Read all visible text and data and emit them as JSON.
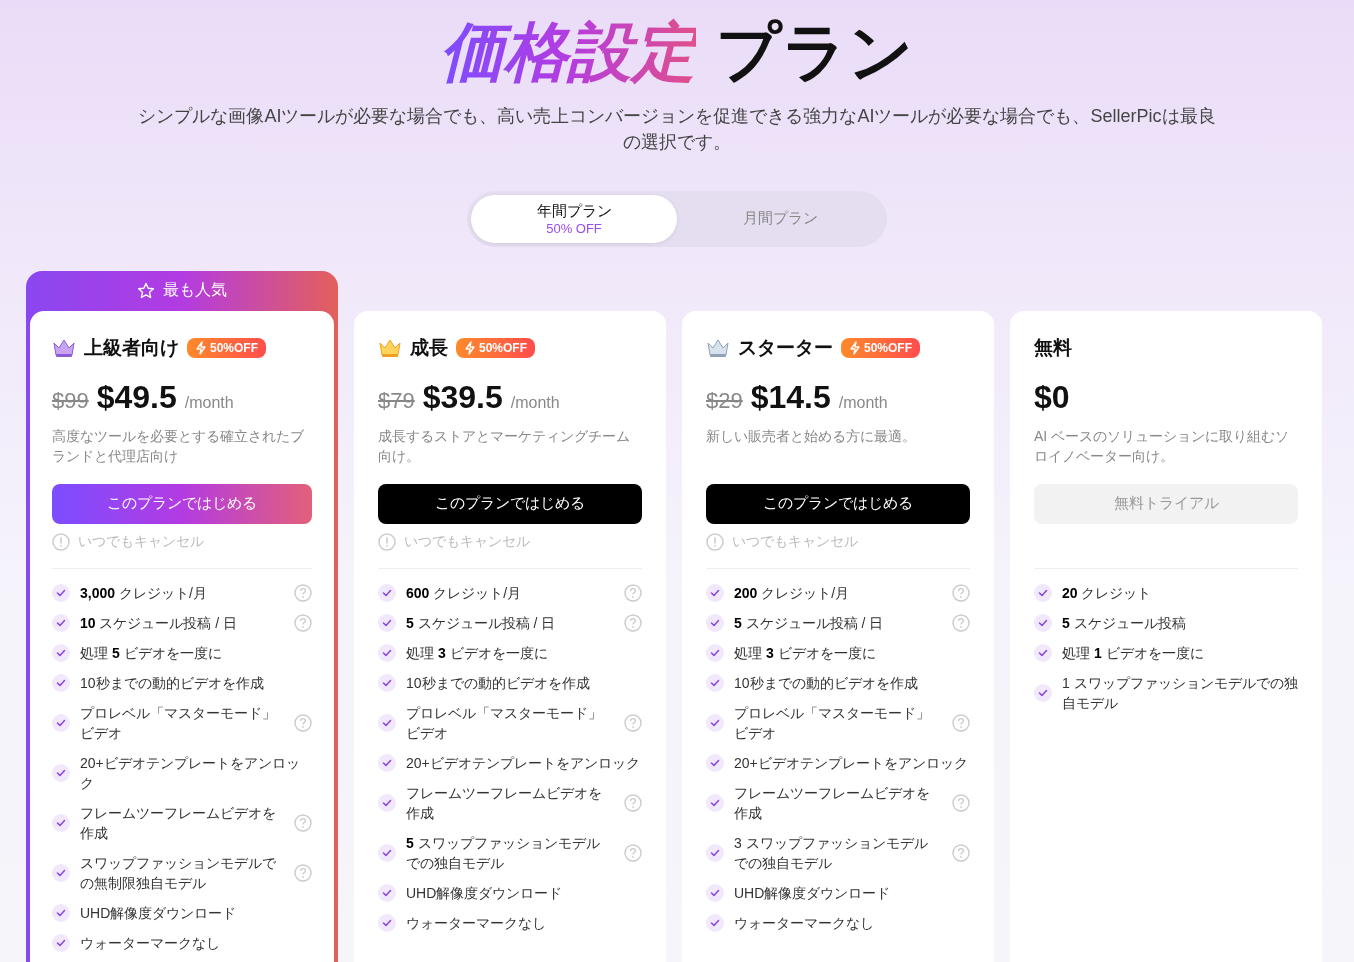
{
  "header": {
    "title_highlight": "価格設定",
    "title_rest": "プラン",
    "subtitle": "シンプルな画像AIツールが必要な場合でも、高い売上コンバージョンを促進できる強力なAIツールが必要な場合でも、SellerPicは最良の選択です。"
  },
  "billing_toggle": [
    {
      "label": "年間プラン",
      "note": "50% OFF",
      "selected": true
    },
    {
      "label": "月間プラン",
      "selected": false
    }
  ],
  "plans": [
    {
      "banner": "最も人気",
      "kind": "purple_crown",
      "name": "上級者向け",
      "badge": "50%OFF",
      "old_price": "$99",
      "price": "$49.5",
      "period": "/month",
      "description": "高度なツールを必要とする確立されたブランドと代理店向け",
      "button": {
        "label": "このプランではじめる",
        "kind": "gradient"
      },
      "cancel_note": "いつでもキャンセル",
      "features": [
        {
          "text": "**3,000** クレジット/月",
          "help": true
        },
        {
          "text": "**10** スケジュール投稿 / 日",
          "help": true
        },
        {
          "text": "処理 **5** ビデオを一度に",
          "help": false
        },
        {
          "text": "10秒までの動的ビデオを作成",
          "help": false
        },
        {
          "text": "プロレベル「マスターモード」ビデオ",
          "help": true
        },
        {
          "text": "20+ビデオテンプレートをアンロック",
          "help": false
        },
        {
          "text": "フレームツーフレームビデオを作成",
          "help": true
        },
        {
          "text": "スワップファッションモデルでの無制限独自モデル",
          "help": true
        },
        {
          "text": "UHD解像度ダウンロード",
          "help": false
        },
        {
          "text": "ウォーターマークなし",
          "help": false
        }
      ]
    },
    {
      "kind": "gold_crown",
      "name": "成長",
      "badge": "50%OFF",
      "old_price": "$79",
      "price": "$39.5",
      "period": "/month",
      "description": "成長するストアとマーケティングチーム向け。",
      "button": {
        "label": "このプランではじめる",
        "kind": "dark"
      },
      "cancel_note": "いつでもキャンセル",
      "features": [
        {
          "text": "**600** クレジット/月",
          "help": true
        },
        {
          "text": "**5** スケジュール投稿 / 日",
          "help": true
        },
        {
          "text": "処理 **3** ビデオを一度に",
          "help": false
        },
        {
          "text": "10秒までの動的ビデオを作成",
          "help": false
        },
        {
          "text": "プロレベル「マスターモード」ビデオ",
          "help": true
        },
        {
          "text": "20+ビデオテンプレートをアンロック",
          "help": false
        },
        {
          "text": "フレームツーフレームビデオを作成",
          "help": true
        },
        {
          "text": "**5** スワップファッションモデルでの独自モデル",
          "help": true
        },
        {
          "text": "UHD解像度ダウンロード",
          "help": false
        },
        {
          "text": "ウォーターマークなし",
          "help": false
        }
      ]
    },
    {
      "kind": "silver_crown",
      "name": "スターター",
      "badge": "50%OFF",
      "old_price": "$29",
      "price": "$14.5",
      "period": "/month",
      "description": "新しい販売者と始める方に最適。",
      "button": {
        "label": "このプランではじめる",
        "kind": "dark"
      },
      "cancel_note": "いつでもキャンセル",
      "features": [
        {
          "text": "**200** クレジット/月",
          "help": true
        },
        {
          "text": "**5** スケジュール投稿 / 日",
          "help": true
        },
        {
          "text": "処理 **3** ビデオを一度に",
          "help": false
        },
        {
          "text": "10秒までの動的ビデオを作成",
          "help": false
        },
        {
          "text": "プロレベル「マスターモード」ビデオ",
          "help": true
        },
        {
          "text": "20+ビデオテンプレートをアンロック",
          "help": false
        },
        {
          "text": "フレームツーフレームビデオを作成",
          "help": true
        },
        {
          "text": "3 スワップファッションモデルでの独自モデル",
          "help": true
        },
        {
          "text": "UHD解像度ダウンロード",
          "help": false
        },
        {
          "text": "ウォーターマークなし",
          "help": false
        }
      ]
    },
    {
      "kind": "plain",
      "name": "無料",
      "price": "$0",
      "description": "AI ベースのソリューションに取り組むソロイノベーター向け。",
      "button": {
        "label": "無料トライアル",
        "kind": "muted"
      },
      "features": [
        {
          "text": "**20** クレジット",
          "help": false
        },
        {
          "text": "**5** スケジュール投稿",
          "help": false
        },
        {
          "text": "処理 **1** ビデオを一度に",
          "help": false
        },
        {
          "text": "1 スワップファッションモデルでの独自モデル",
          "help": false
        }
      ]
    }
  ]
}
